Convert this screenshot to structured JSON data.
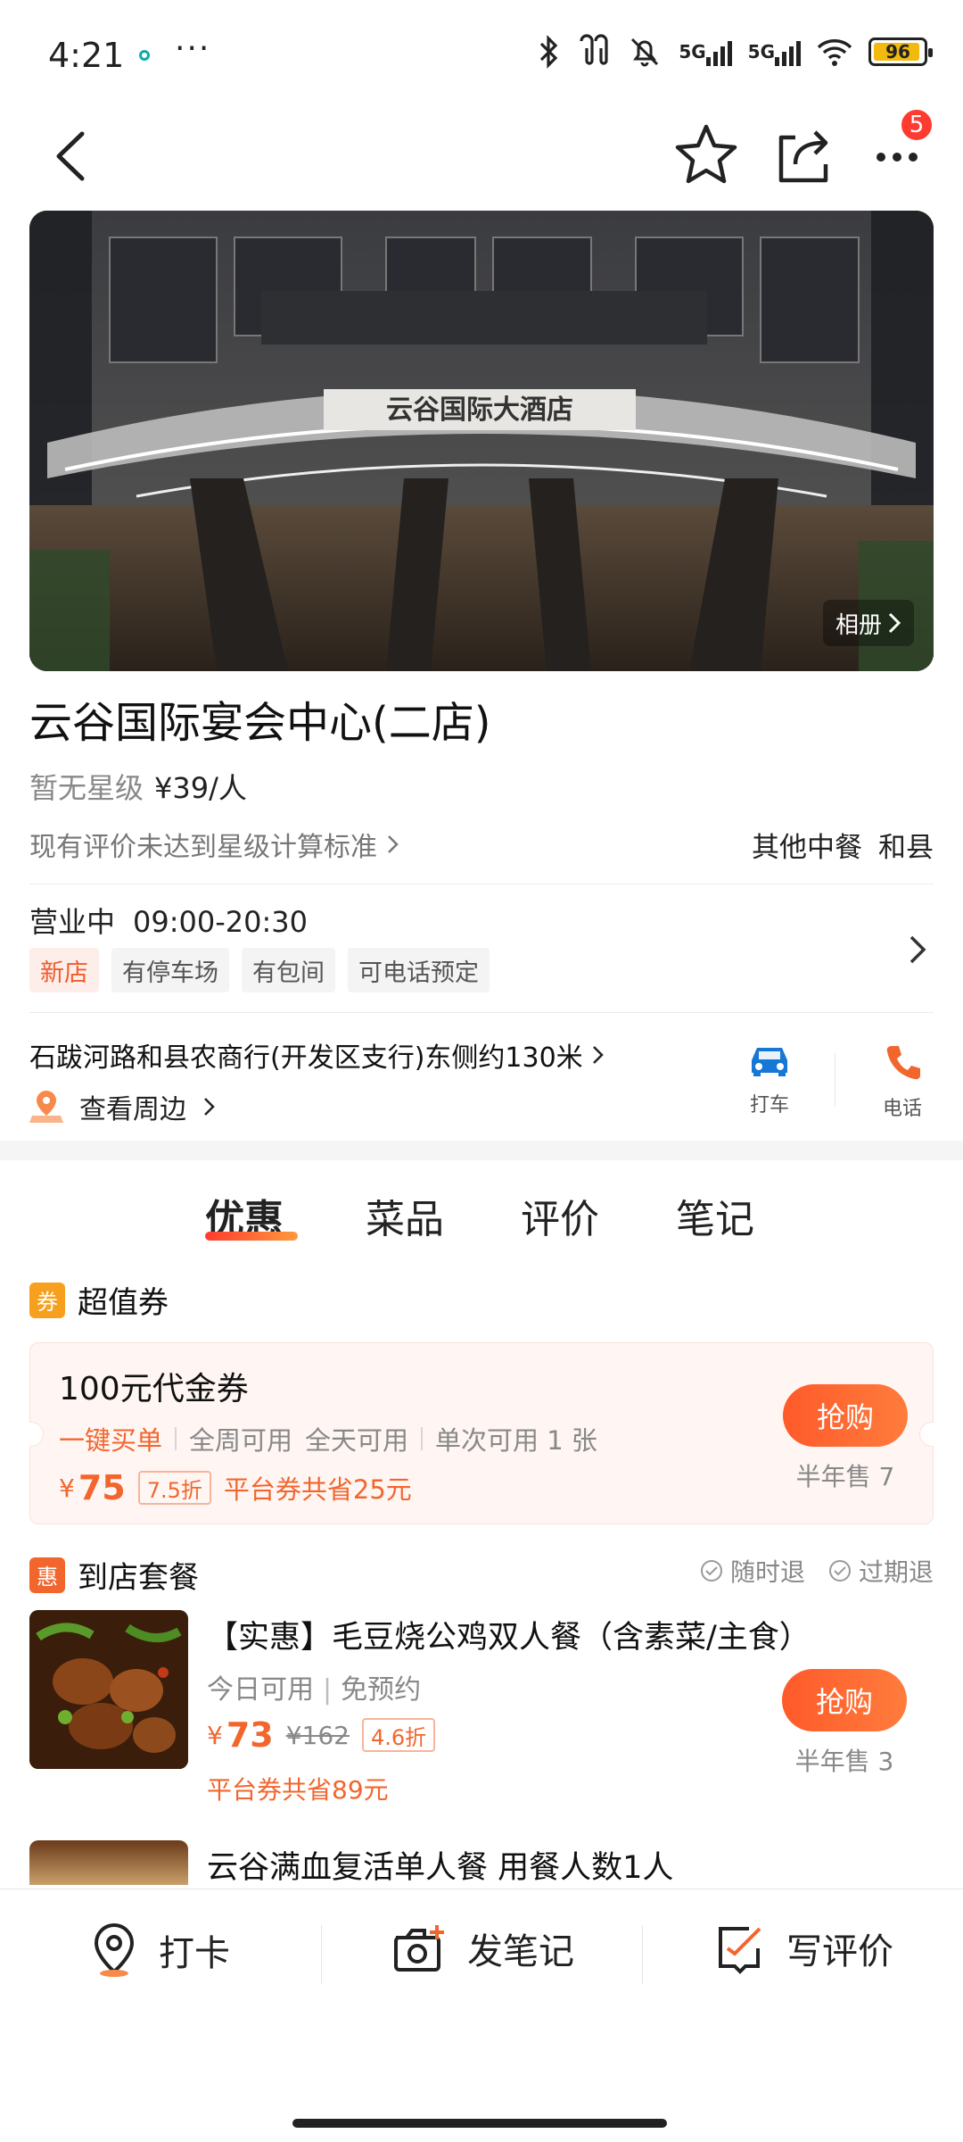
{
  "status_bar": {
    "time": "4:21",
    "more": "···",
    "net1": "5G",
    "net2": "5G",
    "battery": "96"
  },
  "nav": {
    "badge": "5"
  },
  "hero": {
    "album_label": "相册"
  },
  "store": {
    "name": "云谷国际宴会中心(二店)",
    "rating": "暂无星级",
    "price": "¥39/人",
    "rating_note": "现有评价未达到星级计算标准",
    "category": "其他中餐",
    "area": "和县",
    "status": "营业中",
    "hours": "09:00-20:30",
    "tags": [
      "新店",
      "有停车场",
      "有包间",
      "可电话预定"
    ],
    "address": "石跋河路和县农商行(开发区支行)东侧约130米",
    "nearby": "查看周边",
    "taxi_label": "打车",
    "phone_label": "电话"
  },
  "tabs": [
    "优惠",
    "菜品",
    "评价",
    "笔记"
  ],
  "coupons_section": {
    "badge": "券",
    "title": "超值券",
    "coupon": {
      "title": "100元代金券",
      "feature": "一键买单",
      "usage1": "全周可用",
      "usage2": "全天可用",
      "limit": "单次可用 1 张",
      "currency": "¥",
      "price": "75",
      "discount": "7.5折",
      "saving": "平台券共省25元",
      "buy_label": "抢购",
      "sold": "半年售 7"
    }
  },
  "package_section": {
    "badge": "惠",
    "title": "到店套餐",
    "refund1": "随时退",
    "refund2": "过期退",
    "deal1": {
      "title": "【实惠】毛豆烧公鸡双人餐（含素菜/主食）",
      "sub1": "今日可用",
      "sub2": "免预约",
      "currency": "¥",
      "price": "73",
      "original": "¥162",
      "discount": "4.6折",
      "saving": "平台券共省89元",
      "buy_label": "抢购",
      "sold": "半年售 3"
    },
    "deal2": {
      "title": "云谷满血复活单人餐 用餐人数1人"
    }
  },
  "bottom_bar": {
    "checkin": "打卡",
    "note": "发笔记",
    "review": "写评价"
  },
  "colors": {
    "accent": "#f2662e",
    "badge_red": "#ff3b30",
    "taxi_blue": "#1677d6"
  }
}
